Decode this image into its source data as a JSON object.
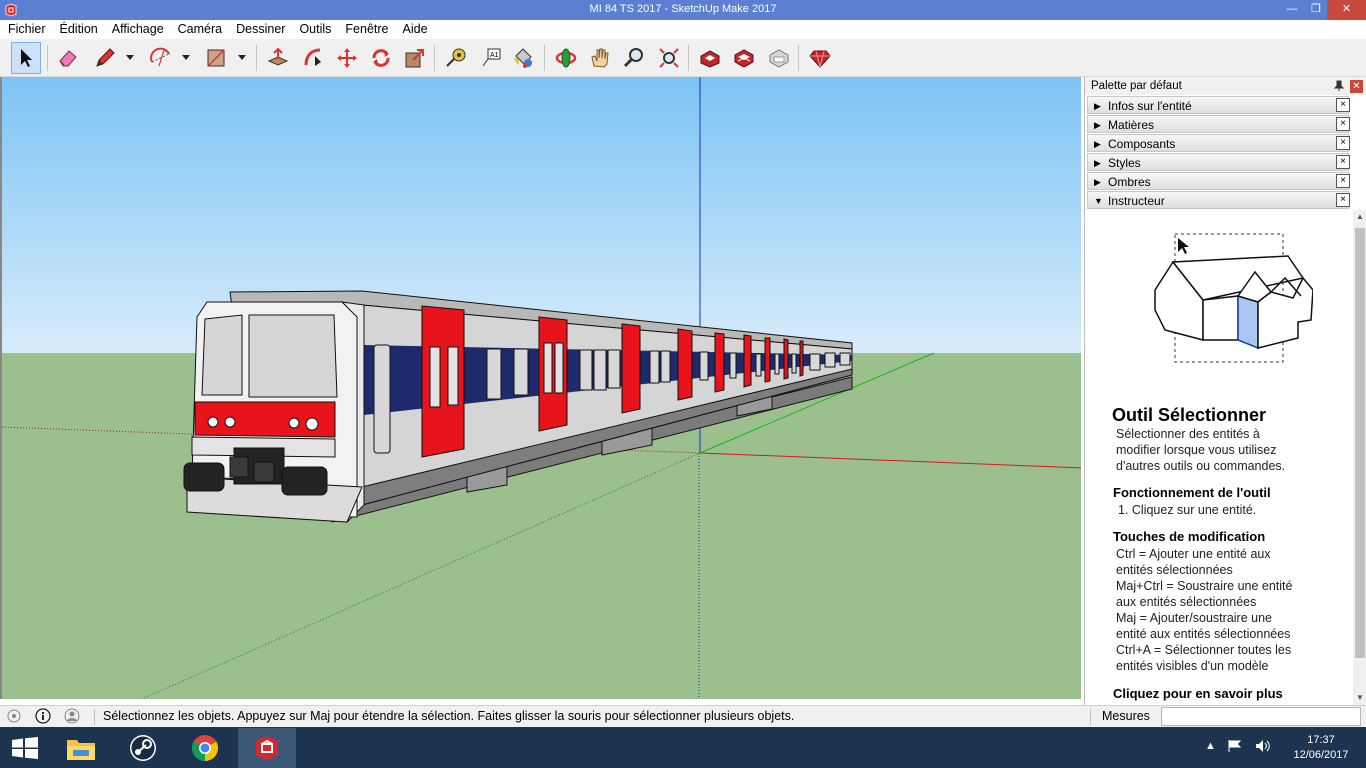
{
  "window": {
    "title": "MI 84  TS 2017 - SketchUp Make 2017",
    "minimize": "—",
    "maximize": "❐",
    "close": "✕"
  },
  "menu": [
    "Fichier",
    "Édition",
    "Affichage",
    "Caméra",
    "Dessiner",
    "Outils",
    "Fenêtre",
    "Aide"
  ],
  "toolbar": {
    "tools": [
      "select-icon",
      "eraser-icon",
      "pencil-icon",
      "arc-icon",
      "rectangle-icon",
      "push-pull-icon",
      "follow-me-icon",
      "move-icon",
      "rotate-icon",
      "scale-icon",
      "tape-measure-icon",
      "text-icon",
      "paint-bucket-icon",
      "orbit-icon",
      "pan-icon",
      "zoom-icon",
      "zoom-extents-icon",
      "warehouse-icon",
      "extension-warehouse-icon",
      "layout-icon",
      "ruby-icon"
    ],
    "active": "select-icon"
  },
  "tray": {
    "title": "Palette par défaut",
    "pin": "📌",
    "close": "✕",
    "panels": [
      {
        "label": "Infos sur l'entité",
        "expanded": false
      },
      {
        "label": "Matières",
        "expanded": false
      },
      {
        "label": "Composants",
        "expanded": false
      },
      {
        "label": "Styles",
        "expanded": false
      },
      {
        "label": "Ombres",
        "expanded": false
      },
      {
        "label": "Instructeur",
        "expanded": true
      }
    ],
    "panel_close": "×",
    "collapsed_arrow": "▶",
    "expanded_arrow": "▼"
  },
  "instructor": {
    "title": "Outil Sélectionner",
    "description": [
      "Sélectionner des entités à",
      "modifier lorsque vous utilisez",
      "d'autres outils ou commandes."
    ],
    "operation_heading": "Fonctionnement de l'outil",
    "operation_steps": [
      "1. Cliquez sur une entité."
    ],
    "modifiers_heading": "Touches de modification",
    "modifiers": [
      "Ctrl = Ajouter une entité aux",
      "entités sélectionnées",
      "Maj+Ctrl = Soustraire une entité",
      "aux entités sélectionnées",
      "Maj = Ajouter/soustraire une",
      "entité aux entités sélectionnées",
      "Ctrl+A = Sélectionner toutes les",
      "entités visibles d'un modèle"
    ],
    "learn_more": "Cliquez pour en savoir plus"
  },
  "statusbar": {
    "hint": "Sélectionnez les objets. Appuyez sur Maj pour étendre la sélection. Faites glisser la souris pour sélectionner plusieurs objets.",
    "measures_label": "Mesures",
    "measures_value": ""
  },
  "taskbar": {
    "apps": [
      "file-explorer-icon",
      "steam-icon",
      "chrome-icon",
      "sketchup-icon"
    ],
    "active_app": "sketchup-icon",
    "time": "17:37",
    "date": "12/06/2017"
  },
  "colors": {
    "sky_top": "#7fc4f4",
    "sky_bottom": "#d6ebf9",
    "ground": "#9cbf8e",
    "train_red": "#e8141c",
    "train_blue": "#1e2a6b",
    "train_grey": "#d4d4d4"
  }
}
